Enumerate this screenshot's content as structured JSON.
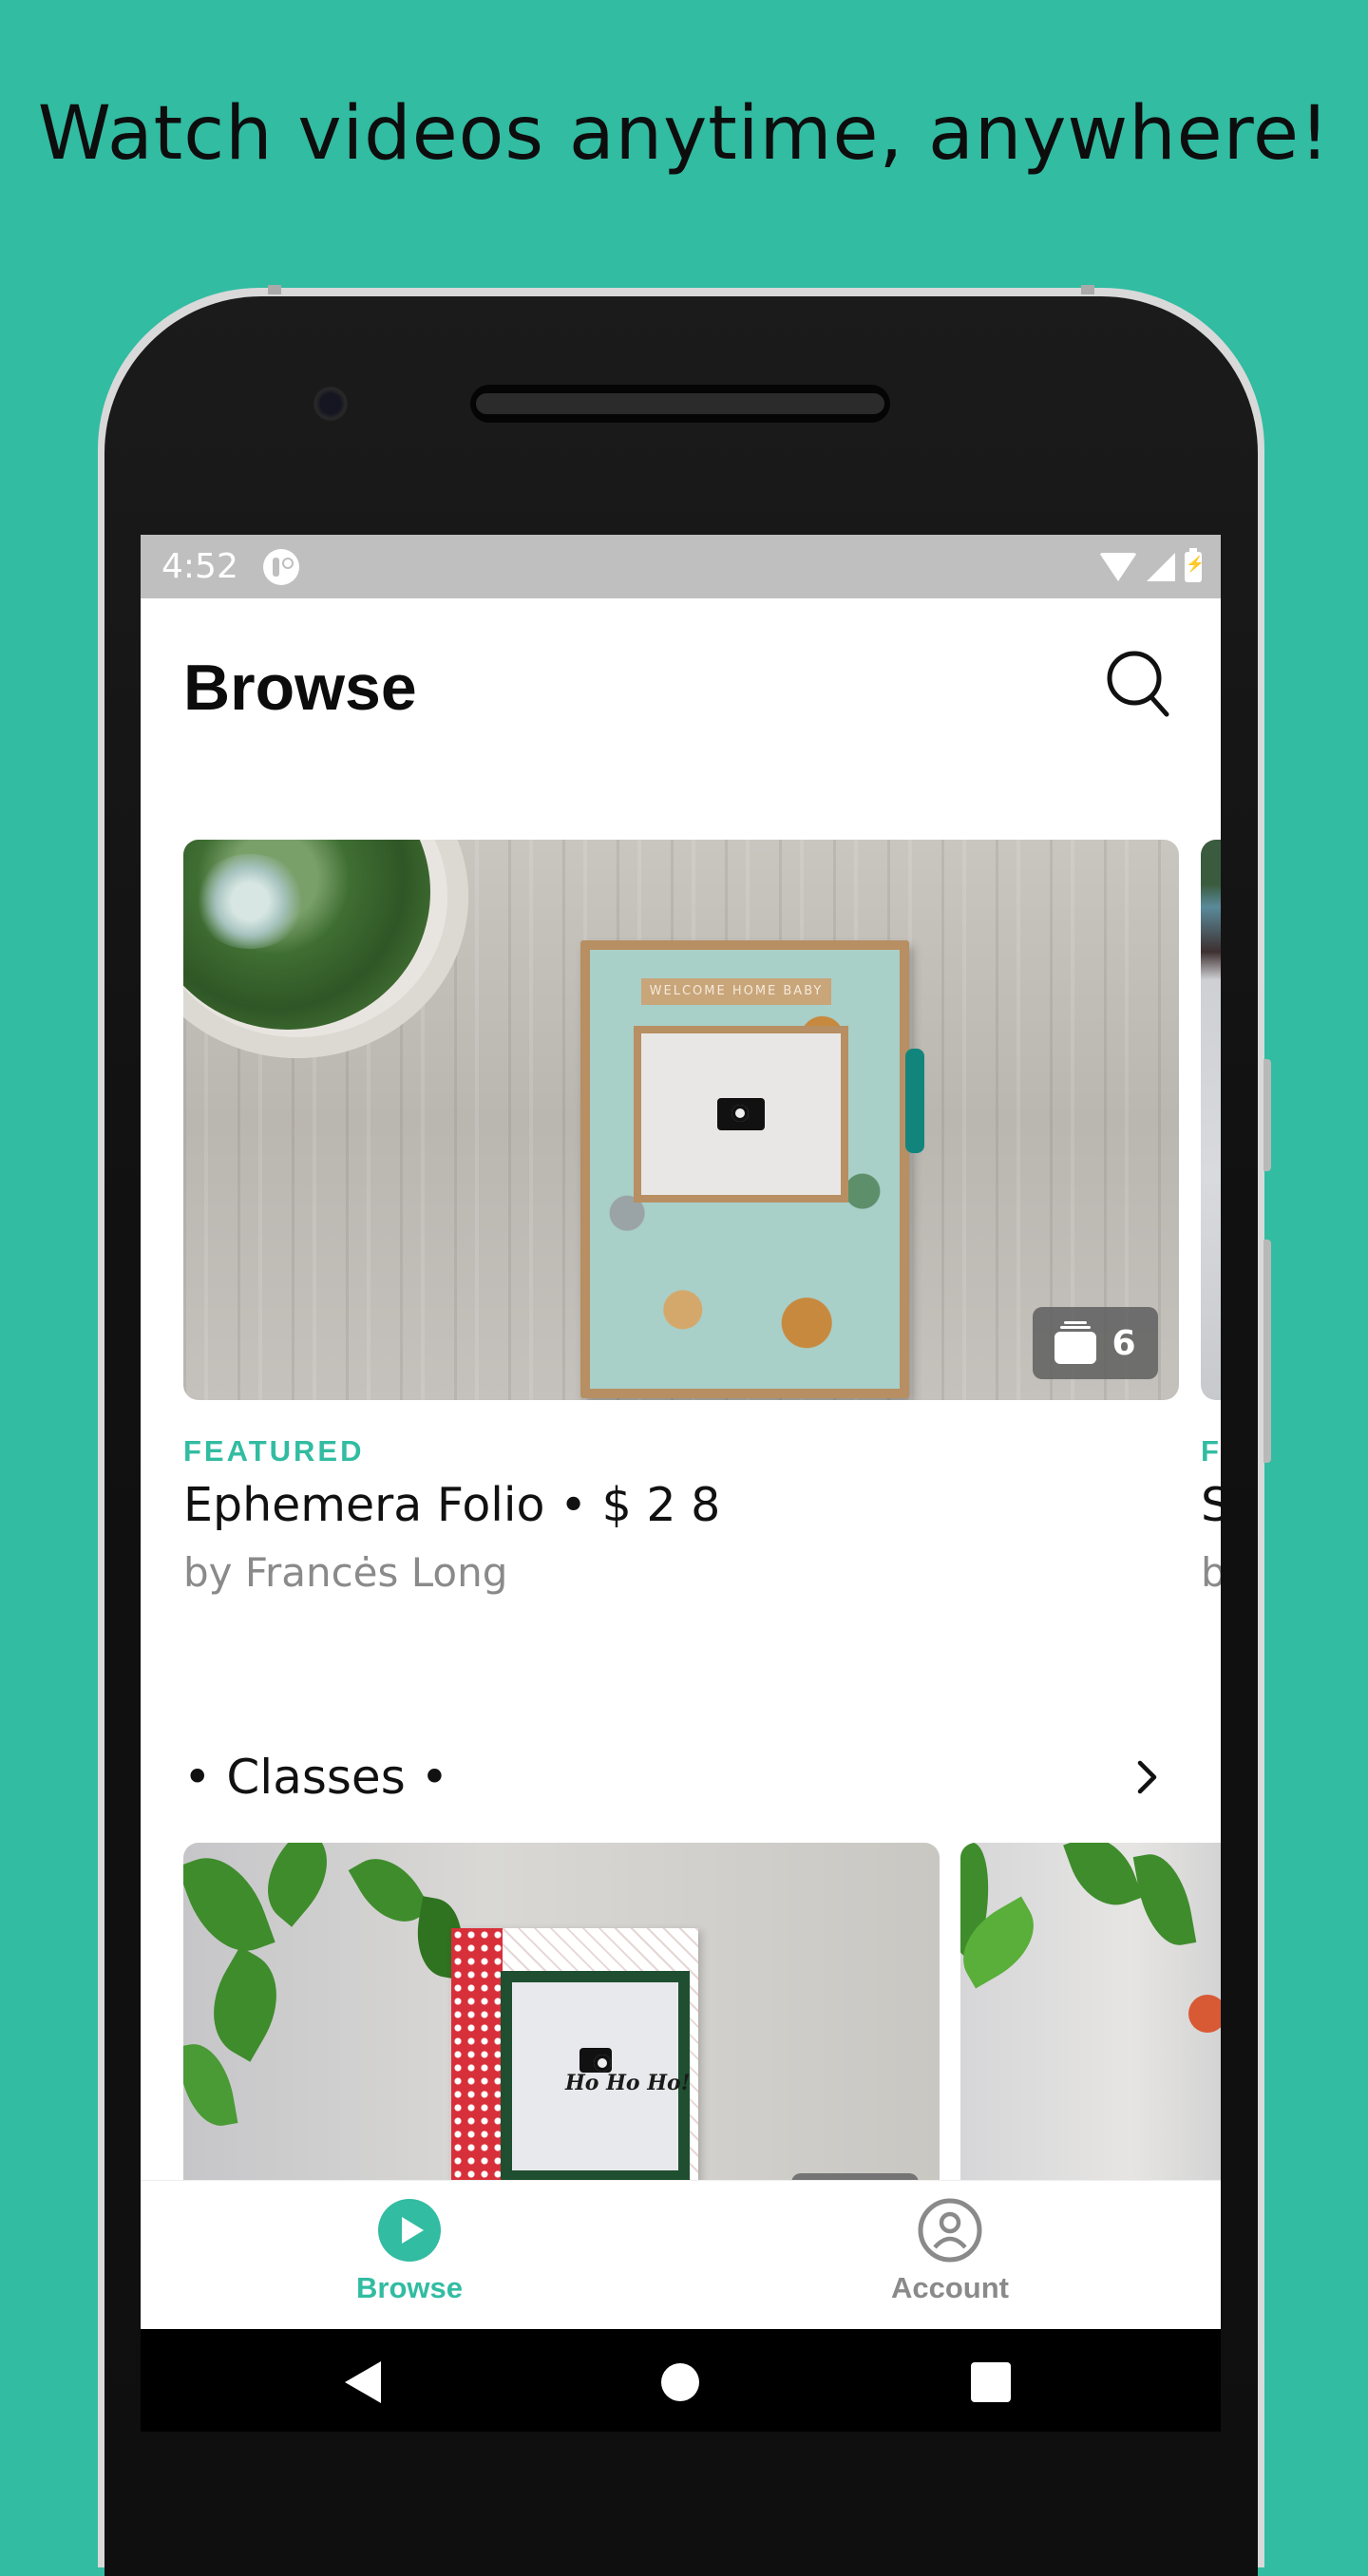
{
  "promo": {
    "headline": "Watch videos anytime, anywhere!",
    "background_color": "#32bca2"
  },
  "status_bar": {
    "time": "4:52",
    "icons": [
      "notification-app-icon",
      "wifi-icon",
      "signal-icon",
      "battery-charging-icon"
    ]
  },
  "header": {
    "title": "Browse",
    "search_icon": "search-icon"
  },
  "featured": {
    "items": [
      {
        "label": "FEATURED",
        "title": "Ephemera Folio • $ 2 8",
        "author": "by Francės Long",
        "video_count": "6",
        "image_caption_text": "WELCOME HOME BABY"
      },
      {
        "label": "F",
        "title": "S",
        "author": "b"
      }
    ]
  },
  "classes_section": {
    "title": "• Classes •",
    "chevron_icon": "chevron-right-icon",
    "cards": [
      {
        "image_text": "Ho Ho Ho!"
      },
      {
        "image_text": ""
      }
    ]
  },
  "bottom_nav": {
    "items": [
      {
        "label": "Browse",
        "icon": "play-circle-icon",
        "active": true
      },
      {
        "label": "Account",
        "icon": "account-circle-icon",
        "active": false
      }
    ],
    "active_color": "#32bca2",
    "inactive_color": "#8a8a8a"
  },
  "system_nav": {
    "buttons": [
      "back-icon",
      "home-icon",
      "recents-icon"
    ]
  }
}
